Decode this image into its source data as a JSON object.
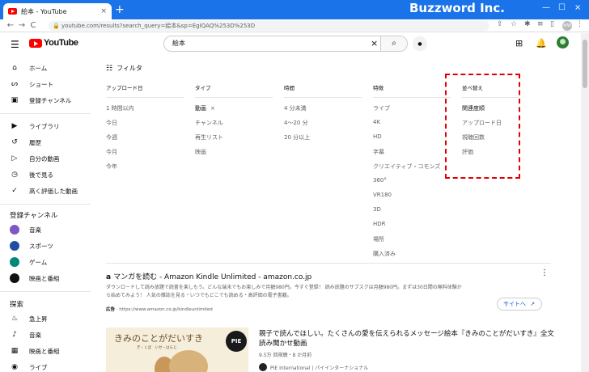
{
  "browser": {
    "tab_title": "絵本 - YouTube",
    "tab_close": "×",
    "new_tab": "+",
    "url": "youtube.com/results?search_query=絵本&sp=EgIQAQ%253D%253D",
    "watermark": "Buzzword Inc.",
    "window_controls": [
      "—",
      "☐",
      "×"
    ],
    "nav": [
      "←",
      "→",
      "C"
    ],
    "profile_initials": "WW"
  },
  "masthead": {
    "logo_text": "YouTube",
    "search_query": "絵本",
    "clear_glyph": "×",
    "search_glyph": "⌕",
    "mic_glyph": "●"
  },
  "sidebar": {
    "main": [
      {
        "label": "ホーム",
        "icon": "⌂"
      },
      {
        "label": "ショート",
        "icon": "ꟹ"
      },
      {
        "label": "登録チャンネル",
        "icon": ""
      }
    ],
    "library": [
      {
        "label": "ライブラリ",
        "icon": "▶"
      },
      {
        "label": "履歴",
        "icon": "↺"
      },
      {
        "label": "自分の動画",
        "icon": "▷"
      },
      {
        "label": "後で見る",
        "icon": "◷"
      },
      {
        "label": "高く評価した動画",
        "icon": "👍"
      }
    ],
    "subscriptions_heading": "登録チャンネル",
    "subscriptions": [
      {
        "label": "音楽",
        "color": "#7e57c2"
      },
      {
        "label": "スポーツ",
        "color": "#1e4fa3"
      },
      {
        "label": "ゲーム",
        "color": "#00897b"
      },
      {
        "label": "映画と番組",
        "color": "#111111"
      }
    ],
    "explore_heading": "探索",
    "explore": [
      {
        "label": "急上昇",
        "icon": "🔥"
      },
      {
        "label": "音楽",
        "icon": "♪"
      },
      {
        "label": "映画と番組",
        "icon": "▦"
      },
      {
        "label": "ライブ",
        "icon": "◉"
      }
    ]
  },
  "filters": {
    "title": "フィルタ",
    "columns": [
      {
        "heading": "アップロード日",
        "options": [
          "1 時間以内",
          "今日",
          "今週",
          "今月",
          "今年"
        ]
      },
      {
        "heading": "タイプ",
        "options": [
          "動画",
          "チャンネル",
          "再生リスト",
          "映画"
        ],
        "active": 0,
        "remove_glyph": "×"
      },
      {
        "heading": "時間",
        "options": [
          "4 分未満",
          "4～20 分",
          "20 分以上"
        ]
      },
      {
        "heading": "特徴",
        "options": [
          "ライブ",
          "4K",
          "HD",
          "字幕",
          "クリエイティブ・コモンズ",
          "360°",
          "VR180",
          "3D",
          "HDR",
          "場所",
          "購入済み"
        ]
      },
      {
        "heading": "並べ替え",
        "options": [
          "関連度順",
          "アップロード日",
          "視聴回数",
          "評価"
        ]
      }
    ]
  },
  "ad": {
    "brand_mark": "a",
    "title": "マンガを読む - Amazon Kindle Unlimited - amazon.co.jp",
    "description_line1": "ダウンロードして読み放題で読書を楽しもう。どんな端末でもお楽しみで月額980円。今すぐ登録！ 読み放題のサブスクは月額980円。まずは30日間の無料体験か",
    "description_line2": "ら始めてみよう！ 人気の雑誌を見る・いつでもどこでも読める・高評価の電子書籍。",
    "label": "広告",
    "url": "https://www.amazon.co.jp/kindleunlimited",
    "site_button": "サイトへ",
    "more_glyph": "⋮"
  },
  "video": {
    "thumbnail_text": "きみのことがだいすき",
    "thumbnail_sub": "ぎ・くぼ　いせ・はらじ",
    "thumbnail_badge": "PIE",
    "title": "親子で読んでほしい。たくさんの愛を伝えられるメッセージ絵本『きみのことがだいすき』全文読み聞かせ動画",
    "meta": "9.5万 回視聴・8 か月前",
    "channel": "PIE International | パイインターナショナル"
  },
  "colors": {
    "browser_accent": "#1a73e8",
    "youtube_red": "#ff0000",
    "highlight": "#e00000",
    "link": "#065fd4"
  }
}
